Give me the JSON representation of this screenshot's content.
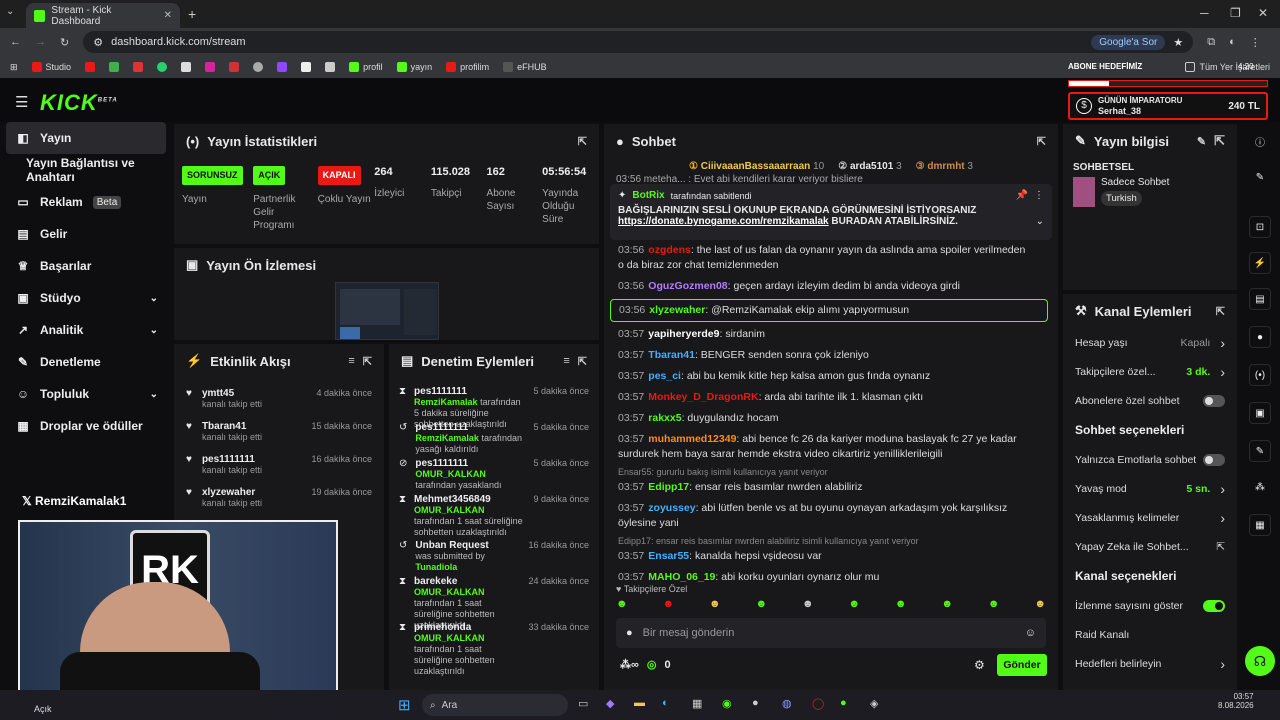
{
  "browser": {
    "tab_title": "Stream - Kick Dashboard",
    "url": "dashboard.kick.com/stream",
    "google_btn": "Google'a Sor",
    "bookmarks": [
      "Studio",
      "",
      "",
      "",
      "",
      "",
      "",
      "",
      "",
      "",
      "",
      "profil",
      "yayın",
      "profilim",
      "eFHUB"
    ],
    "all_bookmarks": "Tüm Yer İşaretleri"
  },
  "overlay": {
    "goal": "ABONE HEDEFİMİZ",
    "emperor_title": "GÜNÜN İMPARATORU",
    "emperor_name": "Serhat_38",
    "emperor_amount": "240 TL",
    "clock": "4:20",
    "webcam_name": "RemziKamalak1"
  },
  "sidebar": {
    "items": [
      {
        "label": "Yayın"
      },
      {
        "label": "Yayın Bağlantısı ve Anahtarı"
      },
      {
        "label": "Reklam",
        "badge": "Beta"
      },
      {
        "label": "Gelir"
      },
      {
        "label": "Başarılar"
      },
      {
        "label": "Stüdyo"
      },
      {
        "label": "Analitik"
      },
      {
        "label": "Denetleme"
      },
      {
        "label": "Topluluk"
      },
      {
        "label": "Droplar ve ödüller"
      }
    ]
  },
  "stats": {
    "title": "Yayın İstatistikleri",
    "items": [
      {
        "badge": "SORUNSUZ",
        "label": "Yayın",
        "color": "#53fc18"
      },
      {
        "badge": "AÇIK",
        "label": "Partnerlik Gelir Programı",
        "color": "#53fc18"
      },
      {
        "badge": "KAPALI",
        "label": "Çoklu Yayın",
        "color": "#e91916"
      },
      {
        "value": "264",
        "label": "İzleyici"
      },
      {
        "value": "115.028",
        "label": "Takipçi"
      },
      {
        "value": "162",
        "label": "Abone Sayısı"
      },
      {
        "value": "05:56:54",
        "label": "Yayında Olduğu Süre"
      }
    ]
  },
  "preview": {
    "title": "Yayın Ön İzlemesi"
  },
  "activity": {
    "title": "Etkinlik Akışı",
    "items": [
      {
        "name": "ymtt45",
        "sub": "kanalı takip etti",
        "time": "4 dakika önce"
      },
      {
        "name": "Tbaran41",
        "sub": "kanalı takip etti",
        "time": "15 dakika önce"
      },
      {
        "name": "pes1111111",
        "sub": "kanalı takip etti",
        "time": "16 dakika önce"
      },
      {
        "name": "xlyzewaher",
        "sub": "kanalı takip etti",
        "time": "19 dakika önce"
      }
    ]
  },
  "modlog": {
    "title": "Denetim Eylemleri",
    "items": [
      {
        "name": "pes1111111",
        "by": "RemziKamalak",
        "desc": "tarafından 5 dakika süreliğine sohbetten uzaklaştırıldı",
        "time": "5 dakika önce"
      },
      {
        "name": "pes1111111",
        "by": "RemziKamalak",
        "desc": "tarafından yasağı kaldırıldı",
        "time": "5 dakika önce"
      },
      {
        "name": "pes1111111",
        "by": "OMUR_KALKAN",
        "desc": "tarafından yasaklandı",
        "time": "5 dakika önce"
      },
      {
        "name": "Mehmet3456849",
        "by": "OMUR_KALKAN",
        "desc": "tarafından 1 saat süreliğine sohbetten uzaklaştırıldı",
        "time": "9 dakika önce"
      },
      {
        "name": "Unban Request",
        "by": "Tunadiola",
        "desc": "was submitted by",
        "time": "16 dakika önce"
      },
      {
        "name": "barekeke",
        "by": "OMUR_KALKAN",
        "desc": "tarafından 1 saat süreliğine sohbetten uzaklaştırıldı",
        "time": "24 dakika önce"
      },
      {
        "name": "primehonda",
        "by": "OMUR_KALKAN",
        "desc": "tarafından 1 saat süreliğine sohbetten uzaklaştırıldı",
        "time": "33 dakika önce"
      }
    ]
  },
  "chat": {
    "title": "Sohbet",
    "top": [
      {
        "name": "CiiivaaanBassaaarraan",
        "count": "10"
      },
      {
        "name": "arda5101",
        "count": "3"
      },
      {
        "name": "dmrmht",
        "count": "3"
      }
    ],
    "pinned_by": "BotRix",
    "pinned_label": "tarafından sabitlendi",
    "pinned_text": "BAĞIŞLARINIZIN SESLİ OKUNUP EKRANDA GÖRÜNMESİNİ İSTİYORSANIZ",
    "pinned_link": "https://donate.bynogame.com/remzikamalak",
    "pinned_tail": " BURADAN ATABİLİRSİNİZ.",
    "top_partial": "03:56 meteha... : Evet abi kendileri karar veriyor bisliere",
    "messages": [
      {
        "time": "03:56",
        "user": "ozgdens",
        "color": "#e91916",
        "text": ": the last of us falan da oynanır yayın da aslında ama spoiler verilmeden o da biraz zor chat temizlenmeden"
      },
      {
        "time": "03:56",
        "user": "OguzGozmen08",
        "color": "#b57bff",
        "text": ": geçen ardayı izleyim dedim bi anda videoya girdi"
      },
      {
        "time": "03:56",
        "user": "xlyzewaher",
        "color": "#53fc18",
        "text": ": @RemziKamalak ekip alımı yapıyormusun",
        "hl": true
      },
      {
        "time": "03:57",
        "user": "yapiheryerde9",
        "color": "#ffffff",
        "text": ": sirdanim"
      },
      {
        "time": "03:57",
        "user": "Tbaran41",
        "color": "#3fb1ff",
        "text": ": BENGER senden sonra çok izleniyo"
      },
      {
        "time": "03:57",
        "user": "pes_ci",
        "color": "#3fb1ff",
        "text": ": abi bu kemik kitle hep kalsa amon gus fında oynanız"
      },
      {
        "time": "03:57",
        "user": "Monkey_D_DragonRK",
        "color": "#e91916",
        "text": ": arda abi tarihte ilk 1. klasman çıktı"
      },
      {
        "time": "03:57",
        "user": "rakxx5",
        "color": "#53fc18",
        "text": ": duygulandız hocam"
      },
      {
        "time": "03:57",
        "user": "muhammed12349",
        "color": "#ff8c1a",
        "text": ": abi bence fc 26 da kariyer moduna baslayak fc 27 ye kadar surdurek hem baya sarar hemde ekstra video cikartiriz yenilliklerileigili"
      },
      {
        "reply": "Ensar55: gururlu bakış isimli kullanıcıya yanıt veriyor",
        "time": "03:57",
        "user": "Edipp17",
        "color": "#53fc18",
        "text": ": ensar reis basımlar nwrden alabiliriz"
      },
      {
        "time": "03:57",
        "user": "zoyussey",
        "color": "#3fb1ff",
        "text": ": abi lütfen benle vs at bu oyunu oynayan arkadaşım yok karşılıksız öylesine yani"
      },
      {
        "reply": "Edipp17: ensar reis basımlar nwrden alabiliriz isimli kullanıcıya yanıt veriyor",
        "time": "03:57",
        "user": "Ensar55",
        "color": "#3fb1ff",
        "text": ": kanalda hepsi vşideosu var"
      },
      {
        "time": "03:57",
        "user": "MAHO_06_19",
        "color": "#53fc18",
        "text": ": abi korku oyunları oynarız olur mu"
      }
    ],
    "followers_only": "Takipçilere Özel",
    "input_placeholder": "Bir mesaj gönderin",
    "points": "0",
    "send": "Gönder"
  },
  "info": {
    "title": "Yayın bilgisi",
    "category_label": "SOHBETSEL",
    "category": "Sadece Sohbet",
    "tag": "Turkish"
  },
  "channel": {
    "title": "Kanal Eylemleri",
    "rows": [
      {
        "label": "Hesap yaşı",
        "value": "Kapalı",
        "type": "chev"
      },
      {
        "label": "Takipçilere özel...",
        "value": "3 dk.",
        "type": "chev",
        "green": true
      },
      {
        "label": "Abonelere özel sohbet",
        "type": "tog",
        "on": false
      }
    ],
    "chat_head": "Sohbet seçenekleri",
    "chat_rows": [
      {
        "label": "Yalnızca Emotlarla sohbet",
        "type": "tog",
        "on": false
      },
      {
        "label": "Yavaş mod",
        "value": "5 sn.",
        "type": "chev",
        "green": true
      },
      {
        "label": "Yasaklanmış kelimeler",
        "type": "chev"
      },
      {
        "label": "Yapay Zeka ile Sohbet...",
        "type": "ext"
      }
    ],
    "chan_head": "Kanal seçenekleri",
    "chan_rows": [
      {
        "label": "İzlenme sayısını göster",
        "type": "tog",
        "on": true
      },
      {
        "label": "Raid Kanalı",
        "type": "none"
      },
      {
        "label": "Hedefleri belirleyin",
        "type": "chev"
      }
    ]
  },
  "taskbar": {
    "search": "Ara",
    "time": "03:57",
    "date": "8.08.2026",
    "weather": "Açık"
  }
}
